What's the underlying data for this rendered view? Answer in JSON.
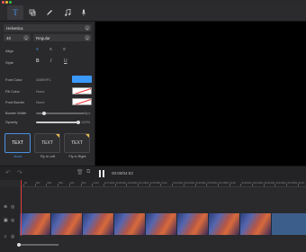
{
  "toolbar": {
    "icons": [
      "text-icon",
      "crop-icon",
      "pen-icon",
      "music-icon",
      "microphone-icon"
    ],
    "glyphs": [
      "T",
      "⊏",
      "✎",
      "♫",
      "🎤"
    ],
    "active": 0
  },
  "panel": {
    "font_family": "Helvetica",
    "font_size": "40",
    "font_weight": "Regular",
    "align_label": "Align",
    "style_label": "Style",
    "style_buttons": [
      "B",
      "I",
      "U"
    ],
    "font_color_label": "Font Color",
    "font_color_value": "#3B99FC",
    "font_color_hex": "#3b99fc",
    "fill_color_label": "Fill Color",
    "fill_color_value": "None",
    "font_border_label": "Font Border",
    "font_border_value": "None",
    "border_width_label": "Border Width",
    "border_width_value": "5px",
    "opacity_label": "Opacity",
    "opacity_value": "100%",
    "presets": [
      {
        "text": "TEXT",
        "label": "None"
      },
      {
        "text": "TEXT",
        "label": "Fly in Left"
      },
      {
        "text": "TEXT",
        "label": "Fly in Right"
      }
    ]
  },
  "transport": {
    "time": "00:00/04:03"
  },
  "timeline": {
    "ticks": [
      "0s",
      "10s",
      "20s",
      "30s",
      "40s",
      "50s",
      "1min",
      "1min10s",
      "1min20s",
      "1min30s",
      "1min40s",
      "1min50s",
      "2min",
      "2min10s",
      "2min20s",
      "2min30s",
      "2min40s",
      "2min50s",
      "3min",
      "3min10s",
      "3min20s",
      "3min30s",
      "3min40s",
      "3min50s",
      "4min"
    ]
  }
}
